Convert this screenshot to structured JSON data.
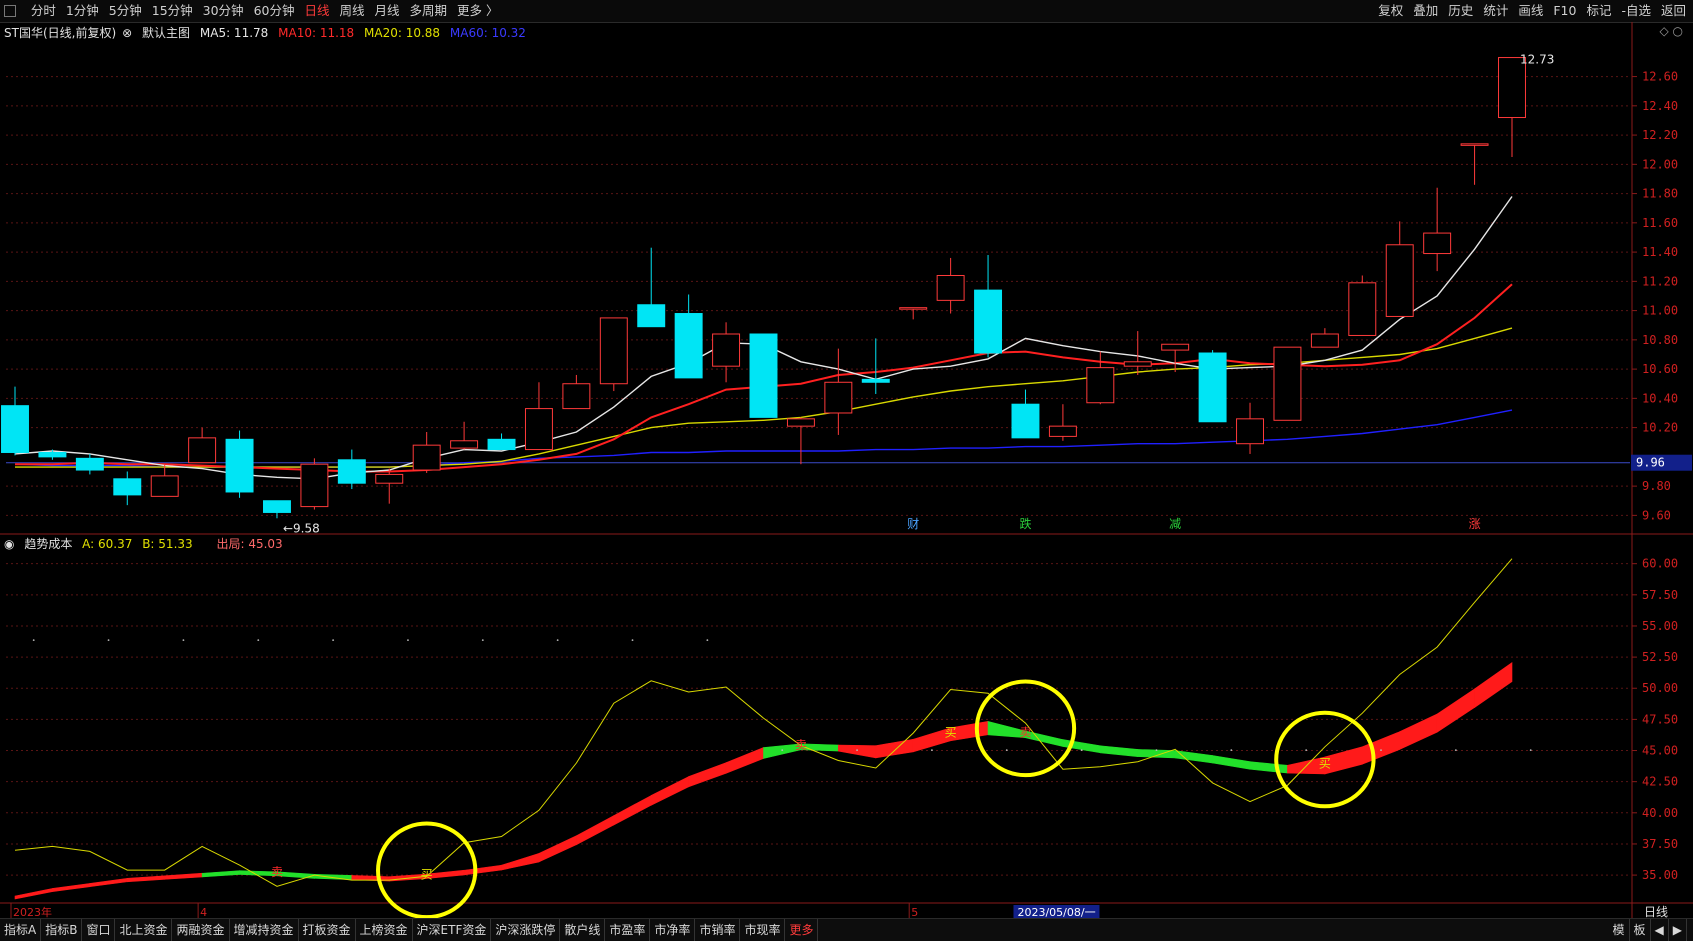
{
  "topbar": {
    "period_tabs": [
      "分时",
      "1分钟",
      "5分钟",
      "15分钟",
      "30分钟",
      "60分钟",
      "日线",
      "周线",
      "月线",
      "多周期",
      "更多 〉"
    ],
    "active_tab": "日线",
    "right_tools": [
      "复权",
      "叠加",
      "历史",
      "统计",
      "画线",
      "F10",
      "标记",
      "-自选",
      "返回"
    ]
  },
  "main_legend": {
    "title": "ST国华(日线,前复权)",
    "mode": "默认主图",
    "ma5": "MA5: 11.78",
    "ma10": "MA10: 11.18",
    "ma20": "MA20: 10.88",
    "ma60": "MA60: 10.32"
  },
  "sub_legend": {
    "title": "趋势成本",
    "a": "A: 60.37",
    "b": "B: 51.33",
    "exit": "出局: 45.03"
  },
  "colors": {
    "up": "#ff3a3a",
    "down": "#00e5f5",
    "ma5": "#e6e6e6",
    "ma10": "#ff2020",
    "ma20": "#d8d800",
    "ma60": "#2020ff",
    "band_up": "#ff1a1a",
    "band_down": "#22e02a",
    "circle": "#ffff00"
  },
  "chart_data": [
    {
      "type": "candlestick",
      "title": "ST国华(日线,前复权)",
      "y_ticks": [
        "12.60",
        "12.40",
        "12.20",
        "12.00",
        "11.80",
        "11.60",
        "11.40",
        "11.20",
        "11.00",
        "10.80",
        "10.60",
        "10.40",
        "10.20",
        "9.80",
        "9.60"
      ],
      "price_marker": "9.96",
      "ylim": [
        9.5,
        12.85
      ],
      "candles": [
        {
          "o": 10.35,
          "h": 10.48,
          "l": 10.01,
          "c": 10.03
        },
        {
          "o": 10.03,
          "h": 10.05,
          "l": 9.98,
          "c": 10.0
        },
        {
          "o": 9.99,
          "h": 10.02,
          "l": 9.88,
          "c": 9.91
        },
        {
          "o": 9.85,
          "h": 9.9,
          "l": 9.67,
          "c": 9.74
        },
        {
          "o": 9.73,
          "h": 9.95,
          "l": 9.73,
          "c": 9.87
        },
        {
          "o": 9.96,
          "h": 10.2,
          "l": 9.96,
          "c": 10.13
        },
        {
          "o": 10.12,
          "h": 10.18,
          "l": 9.72,
          "c": 9.76
        },
        {
          "o": 9.7,
          "h": 9.7,
          "l": 9.58,
          "c": 9.62
        },
        {
          "o": 9.66,
          "h": 9.99,
          "l": 9.64,
          "c": 9.95
        },
        {
          "o": 9.98,
          "h": 10.05,
          "l": 9.78,
          "c": 9.82
        },
        {
          "o": 9.82,
          "h": 9.92,
          "l": 9.68,
          "c": 9.88
        },
        {
          "o": 9.91,
          "h": 10.17,
          "l": 9.89,
          "c": 10.08
        },
        {
          "o": 10.06,
          "h": 10.24,
          "l": 10.05,
          "c": 10.11
        },
        {
          "o": 10.12,
          "h": 10.16,
          "l": 10.05,
          "c": 10.05
        },
        {
          "o": 10.05,
          "h": 10.51,
          "l": 10.05,
          "c": 10.33
        },
        {
          "o": 10.33,
          "h": 10.56,
          "l": 10.33,
          "c": 10.5
        },
        {
          "o": 10.5,
          "h": 10.95,
          "l": 10.45,
          "c": 10.95
        },
        {
          "o": 11.04,
          "h": 11.43,
          "l": 10.89,
          "c": 10.89
        },
        {
          "o": 10.98,
          "h": 11.11,
          "l": 10.54,
          "c": 10.54
        },
        {
          "o": 10.62,
          "h": 10.92,
          "l": 10.51,
          "c": 10.84
        },
        {
          "o": 10.84,
          "h": 10.84,
          "l": 10.27,
          "c": 10.27
        },
        {
          "o": 10.21,
          "h": 10.27,
          "l": 9.95,
          "c": 10.26
        },
        {
          "o": 10.3,
          "h": 10.74,
          "l": 10.15,
          "c": 10.51
        },
        {
          "o": 10.53,
          "h": 10.81,
          "l": 10.43,
          "c": 10.51
        },
        {
          "o": 11.02,
          "h": 11.02,
          "l": 10.94,
          "c": 11.02
        },
        {
          "o": 11.07,
          "h": 11.36,
          "l": 10.98,
          "c": 11.24
        },
        {
          "o": 11.14,
          "h": 11.38,
          "l": 10.68,
          "c": 10.71
        },
        {
          "o": 10.36,
          "h": 10.46,
          "l": 10.13,
          "c": 10.13
        },
        {
          "o": 10.14,
          "h": 10.36,
          "l": 10.11,
          "c": 10.21
        },
        {
          "o": 10.37,
          "h": 10.72,
          "l": 10.36,
          "c": 10.61
        },
        {
          "o": 10.62,
          "h": 10.86,
          "l": 10.56,
          "c": 10.65
        },
        {
          "o": 10.73,
          "h": 10.77,
          "l": 10.58,
          "c": 10.77
        },
        {
          "o": 10.71,
          "h": 10.73,
          "l": 10.24,
          "c": 10.24
        },
        {
          "o": 10.09,
          "h": 10.37,
          "l": 10.02,
          "c": 10.26
        },
        {
          "o": 10.25,
          "h": 10.75,
          "l": 10.25,
          "c": 10.75
        },
        {
          "o": 10.75,
          "h": 10.88,
          "l": 10.75,
          "c": 10.84
        },
        {
          "o": 10.83,
          "h": 11.24,
          "l": 10.83,
          "c": 11.19
        },
        {
          "o": 10.96,
          "h": 11.61,
          "l": 10.96,
          "c": 11.45
        },
        {
          "o": 11.39,
          "h": 11.84,
          "l": 11.27,
          "c": 11.53
        },
        {
          "o": 12.14,
          "h": 12.14,
          "l": 11.86,
          "c": 12.14
        },
        {
          "o": 12.32,
          "h": 12.73,
          "l": 12.05,
          "c": 12.73
        }
      ],
      "ma5": [
        10.02,
        10.04,
        10.02,
        9.98,
        9.94,
        9.92,
        9.88,
        9.86,
        9.85,
        9.89,
        9.91,
        9.99,
        10.05,
        10.04,
        10.1,
        10.17,
        10.34,
        10.55,
        10.64,
        10.78,
        10.77,
        10.65,
        10.6,
        10.53,
        10.6,
        10.62,
        10.67,
        10.81,
        10.76,
        10.72,
        10.69,
        10.64,
        10.6,
        10.61,
        10.62,
        10.66,
        10.73,
        10.94,
        11.1,
        11.42,
        11.78
      ],
      "ma10": [
        9.95,
        9.95,
        9.96,
        9.95,
        9.95,
        9.94,
        9.93,
        9.92,
        9.91,
        9.9,
        9.9,
        9.91,
        9.93,
        9.95,
        9.98,
        10.02,
        10.12,
        10.27,
        10.36,
        10.46,
        10.48,
        10.5,
        10.56,
        10.58,
        10.61,
        10.66,
        10.71,
        10.72,
        10.68,
        10.65,
        10.63,
        10.64,
        10.67,
        10.64,
        10.63,
        10.62,
        10.63,
        10.66,
        10.77,
        10.95,
        11.18
      ],
      "ma20": [
        9.93,
        9.93,
        9.93,
        9.93,
        9.93,
        9.93,
        9.93,
        9.93,
        9.93,
        9.93,
        9.93,
        9.94,
        9.95,
        9.97,
        10.02,
        10.08,
        10.14,
        10.2,
        10.23,
        10.24,
        10.25,
        10.27,
        10.31,
        10.36,
        10.41,
        10.45,
        10.48,
        10.5,
        10.52,
        10.55,
        10.58,
        10.6,
        10.61,
        10.63,
        10.64,
        10.66,
        10.68,
        10.7,
        10.74,
        10.81,
        10.88
      ],
      "ma60": [
        9.95,
        9.94,
        9.94,
        9.94,
        9.93,
        9.93,
        9.93,
        9.93,
        9.93,
        9.93,
        9.93,
        9.94,
        9.96,
        9.97,
        9.99,
        10.0,
        10.01,
        10.03,
        10.03,
        10.04,
        10.04,
        10.04,
        10.04,
        10.05,
        10.05,
        10.06,
        10.06,
        10.07,
        10.07,
        10.08,
        10.09,
        10.09,
        10.1,
        10.11,
        10.12,
        10.14,
        10.16,
        10.19,
        10.22,
        10.27,
        10.32
      ],
      "annotations": [
        {
          "text": "12.73",
          "at": "high"
        },
        {
          "text": "←9.58",
          "at": "low"
        }
      ],
      "event_tags": [
        {
          "text": "财",
          "color": "#4aa3ff",
          "index": 24
        },
        {
          "text": "跌",
          "color": "#2ad03a",
          "index": 27
        },
        {
          "text": "减",
          "color": "#2ad03a",
          "index": 31
        },
        {
          "text": "涨",
          "color": "#ff3a3a",
          "index": 39
        }
      ]
    },
    {
      "type": "line",
      "title": "趋势成本",
      "y_ticks": [
        "60.00",
        "57.50",
        "55.00",
        "52.50",
        "50.00",
        "47.50",
        "45.00",
        "42.50",
        "40.00",
        "37.50",
        "35.00"
      ],
      "ylim": [
        33.0,
        61.5
      ],
      "series": [
        {
          "name": "A",
          "values": [
            37.0,
            37.3,
            36.9,
            35.4,
            35.4,
            37.3,
            35.8,
            34.1,
            35.0,
            34.6,
            34.6,
            34.9,
            37.6,
            38.1,
            40.2,
            44.0,
            48.8,
            50.6,
            49.7,
            50.1,
            47.6,
            45.4,
            44.2,
            43.6,
            46.4,
            49.9,
            49.6,
            47.2,
            43.5,
            43.7,
            44.1,
            45.1,
            42.4,
            40.9,
            42.2,
            45.3,
            48.0,
            51.1,
            53.3,
            56.9,
            60.4
          ]
        },
        {
          "name": "B",
          "values": [
            33.2,
            33.8,
            34.2,
            34.6,
            34.8,
            35.0,
            35.2,
            35.1,
            34.9,
            34.8,
            34.7,
            34.9,
            35.2,
            35.6,
            36.4,
            37.8,
            39.4,
            41.0,
            42.5,
            43.6,
            44.8,
            45.3,
            45.2,
            44.9,
            45.4,
            46.3,
            46.8,
            46.3,
            45.6,
            45.1,
            44.8,
            44.7,
            44.3,
            43.8,
            43.5,
            43.8,
            44.6,
            45.8,
            47.2,
            49.2,
            51.3
          ]
        }
      ],
      "band_colors": [
        "red",
        "red",
        "red",
        "red",
        "red",
        "red",
        "green",
        "green",
        "green",
        "green",
        "red",
        "red",
        "red",
        "red",
        "red",
        "red",
        "red",
        "red",
        "red",
        "red",
        "red",
        "green",
        "green",
        "red",
        "red",
        "red",
        "red",
        "green",
        "green",
        "green",
        "green",
        "green",
        "green",
        "green",
        "green",
        "red",
        "red",
        "red",
        "red",
        "red",
        "red"
      ],
      "signals": [
        {
          "text": "买",
          "index": 11
        },
        {
          "text": "卖",
          "index": 7
        },
        {
          "text": "卖",
          "index": 21
        },
        {
          "text": "买",
          "index": 25
        },
        {
          "text": "卖",
          "index": 27
        },
        {
          "text": "买",
          "index": 35
        }
      ],
      "circled_signals": [
        11,
        27,
        35
      ],
      "exit_level": 45.03,
      "x_labels": [
        {
          "text": "2023年",
          "index": 0
        },
        {
          "text": "4",
          "index": 5
        },
        {
          "text": "5",
          "index": 24
        },
        {
          "text": "2023/05/08/一",
          "index": 27
        }
      ]
    }
  ],
  "side_label": "日线",
  "bottombar": {
    "tabs": [
      "指标A",
      "指标B",
      "窗口",
      "北上资金",
      "两融资金",
      "增减持资金",
      "打板资金",
      "上榜资金",
      "沪深ETF资金",
      "沪深涨跌停",
      "散户线",
      "市盈率",
      "市净率",
      "市销率",
      "市现率",
      "更多"
    ],
    "active_tab": "更多",
    "right": [
      "模",
      "板",
      "◀",
      "▶"
    ]
  }
}
